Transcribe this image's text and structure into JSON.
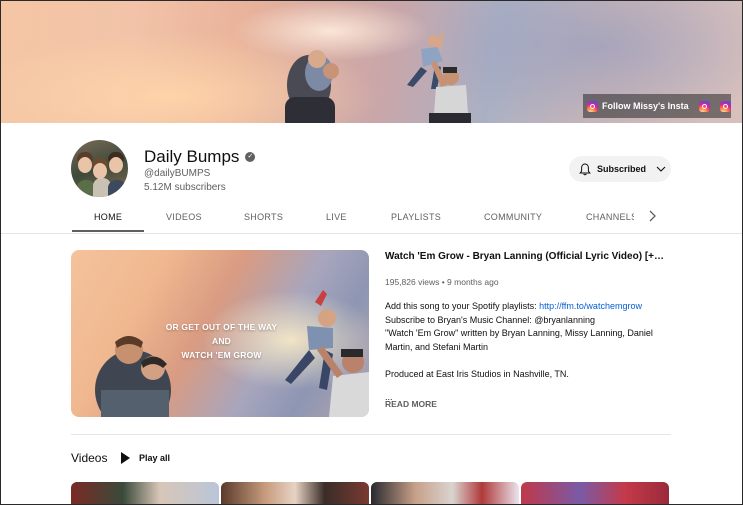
{
  "banner": {
    "link_label": "Follow Missy's Insta",
    "icons": [
      "instagram-icon",
      "instagram-icon",
      "instagram-icon"
    ]
  },
  "channel": {
    "name": "Daily Bumps",
    "handle": "@dailyBUMPS",
    "subscribers": "5.12M subscribers",
    "subscribe_label": "Subscribed"
  },
  "tabs": [
    {
      "label": "HOME",
      "active": true
    },
    {
      "label": "VIDEOS",
      "active": false
    },
    {
      "label": "SHORTS",
      "active": false
    },
    {
      "label": "LIVE",
      "active": false
    },
    {
      "label": "PLAYLISTS",
      "active": false
    },
    {
      "label": "COMMUNITY",
      "active": false
    },
    {
      "label": "CHANNELS",
      "active": false
    }
  ],
  "featured": {
    "thumbnail_caption_1": "OR GET OUT OF THE WAY AND",
    "thumbnail_caption_2": "WATCH 'EM GROW",
    "title": "Watch 'Em Grow - Bryan Lanning (Official Lyric Video) [+ Speci...",
    "views": "195,826 views",
    "age": "9 months ago",
    "meta_sep": " • ",
    "desc_line1_text": "Add this song to your Spotify playlists: ",
    "desc_line1_link": "http://ffm.to/watchemgrow",
    "desc_line2": "Subscribe to Bryan's Music Channel: @bryanlanning",
    "desc_line3": "\"Watch 'Em Grow\"  written by Bryan Lanning, Missy Lanning, Daniel",
    "desc_line4": "Martin, and Stefani Martin",
    "desc_line5": "Produced at East Iris Studios in Nashville, TN.",
    "desc_line6": "...",
    "read_more": "READ MORE"
  },
  "videos_section": {
    "heading": "Videos",
    "play_all": "Play all"
  },
  "colors": {
    "link": "#065fd4",
    "secondary_text": "#606060",
    "button_bg": "#f2f2f2"
  }
}
